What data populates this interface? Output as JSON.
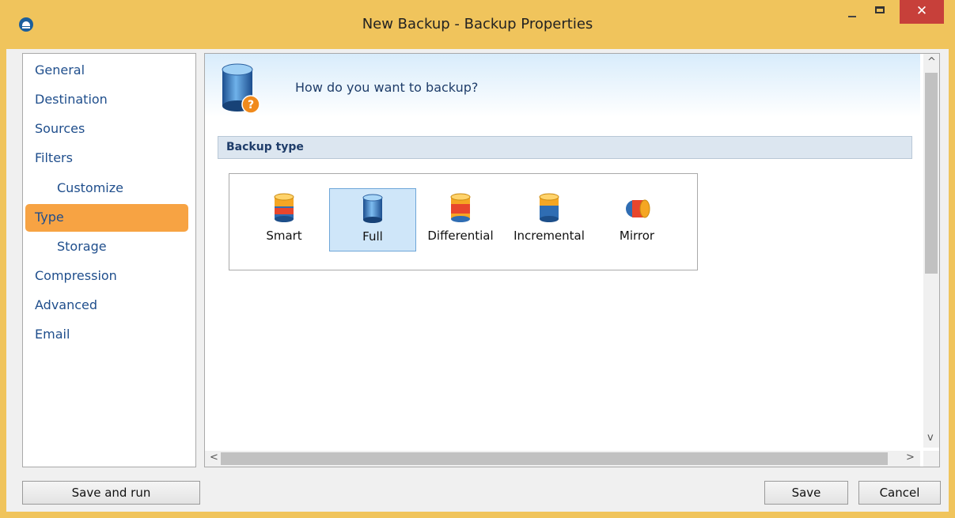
{
  "window": {
    "title": "New Backup - Backup Properties",
    "close_glyph": "✕"
  },
  "nav": {
    "items": [
      {
        "label": "General"
      },
      {
        "label": "Destination"
      },
      {
        "label": "Sources"
      },
      {
        "label": "Filters"
      },
      {
        "label": "Customize"
      },
      {
        "label": "Type"
      },
      {
        "label": "Storage"
      },
      {
        "label": "Compression"
      },
      {
        "label": "Advanced"
      },
      {
        "label": "Email"
      }
    ],
    "active": "Type"
  },
  "main": {
    "question": "How do you want to backup?",
    "section_title": "Backup type",
    "types": [
      {
        "label": "Smart",
        "icon": "smart-backup-icon",
        "selected": false
      },
      {
        "label": "Full",
        "icon": "full-backup-icon",
        "selected": true
      },
      {
        "label": "Differential",
        "icon": "differential-backup-icon",
        "selected": false
      },
      {
        "label": "Incremental",
        "icon": "incremental-backup-icon",
        "selected": false
      },
      {
        "label": "Mirror",
        "icon": "mirror-backup-icon",
        "selected": false
      }
    ]
  },
  "footer": {
    "save_and_run": "Save and run",
    "save": "Save",
    "cancel": "Cancel"
  },
  "colors": {
    "titlebar": "#f0c45c",
    "active_nav": "#f7a343",
    "close": "#c7403a",
    "selection": "#cfe6f9"
  }
}
